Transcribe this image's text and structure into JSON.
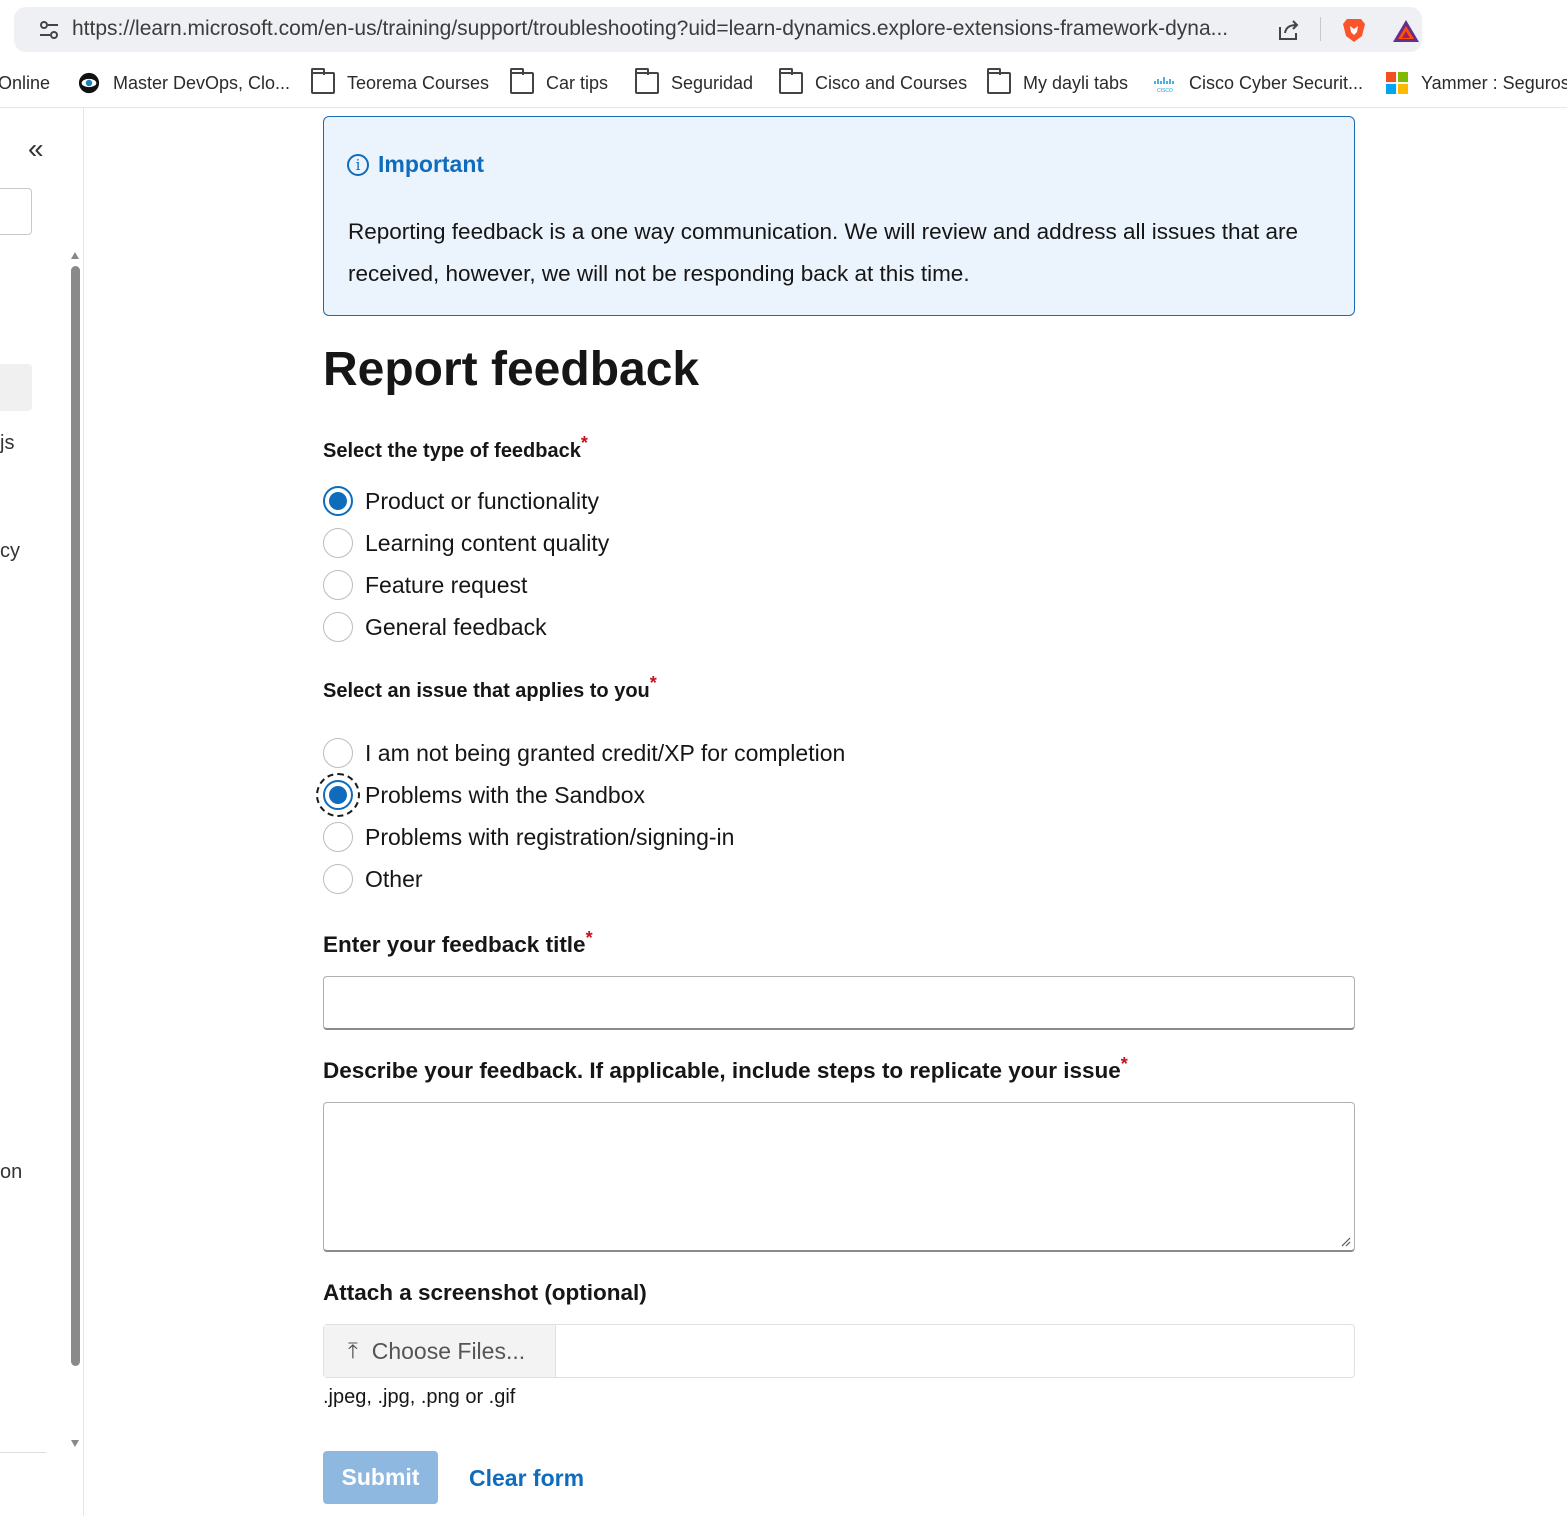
{
  "browser": {
    "url": "https://learn.microsoft.com/en-us/training/support/troubleshooting?uid=learn-dynamics.explore-extensions-framework-dyna..."
  },
  "bookmarks": [
    {
      "label": "Online",
      "icon": "none"
    },
    {
      "label": "Master DevOps, Clo...",
      "icon": "eye-logo-icon"
    },
    {
      "label": "Teorema Courses",
      "icon": "folder-icon"
    },
    {
      "label": "Car tips",
      "icon": "folder-icon"
    },
    {
      "label": "Seguridad",
      "icon": "folder-icon"
    },
    {
      "label": "Cisco and Courses",
      "icon": "folder-icon"
    },
    {
      "label": "My dayli tabs",
      "icon": "folder-icon"
    },
    {
      "label": "Cisco Cyber Securit...",
      "icon": "cisco-logo-icon"
    },
    {
      "label": "Yammer : Seguros U",
      "icon": "microsoft-logo-icon"
    }
  ],
  "sidebar": {
    "fragments": [
      "js",
      "cy",
      "on"
    ]
  },
  "alert": {
    "title": "Important",
    "body": "Reporting feedback is a one way communication. We will review and address all issues that are received, however, we will not be responding back at this time."
  },
  "form": {
    "title": "Report feedback",
    "feedback_type": {
      "label": "Select the type of feedback",
      "options": [
        "Product or functionality",
        "Learning content quality",
        "Feature request",
        "General feedback"
      ],
      "selected": "Product or functionality"
    },
    "issue": {
      "label": "Select an issue that applies to you",
      "options": [
        "I am not being granted credit/XP for completion",
        "Problems with the Sandbox",
        "Problems with registration/signing-in",
        "Other"
      ],
      "selected": "Problems with the Sandbox"
    },
    "feedback_title": {
      "label": "Enter your feedback title",
      "value": ""
    },
    "description": {
      "label": "Describe your feedback. If applicable, include steps to replicate your issue",
      "value": ""
    },
    "screenshot": {
      "label": "Attach a screenshot (optional)",
      "button": "Choose Files...",
      "hint": ".jpeg, .jpg, .png or .gif"
    },
    "required_marker": "*",
    "submit_label": "Submit",
    "clear_label": "Clear form"
  },
  "colors": {
    "accent": "#0f6cbd",
    "required": "#c50f1f",
    "alert_bg": "#ebf3fc",
    "submit_disabled": "#8fb8e0"
  }
}
